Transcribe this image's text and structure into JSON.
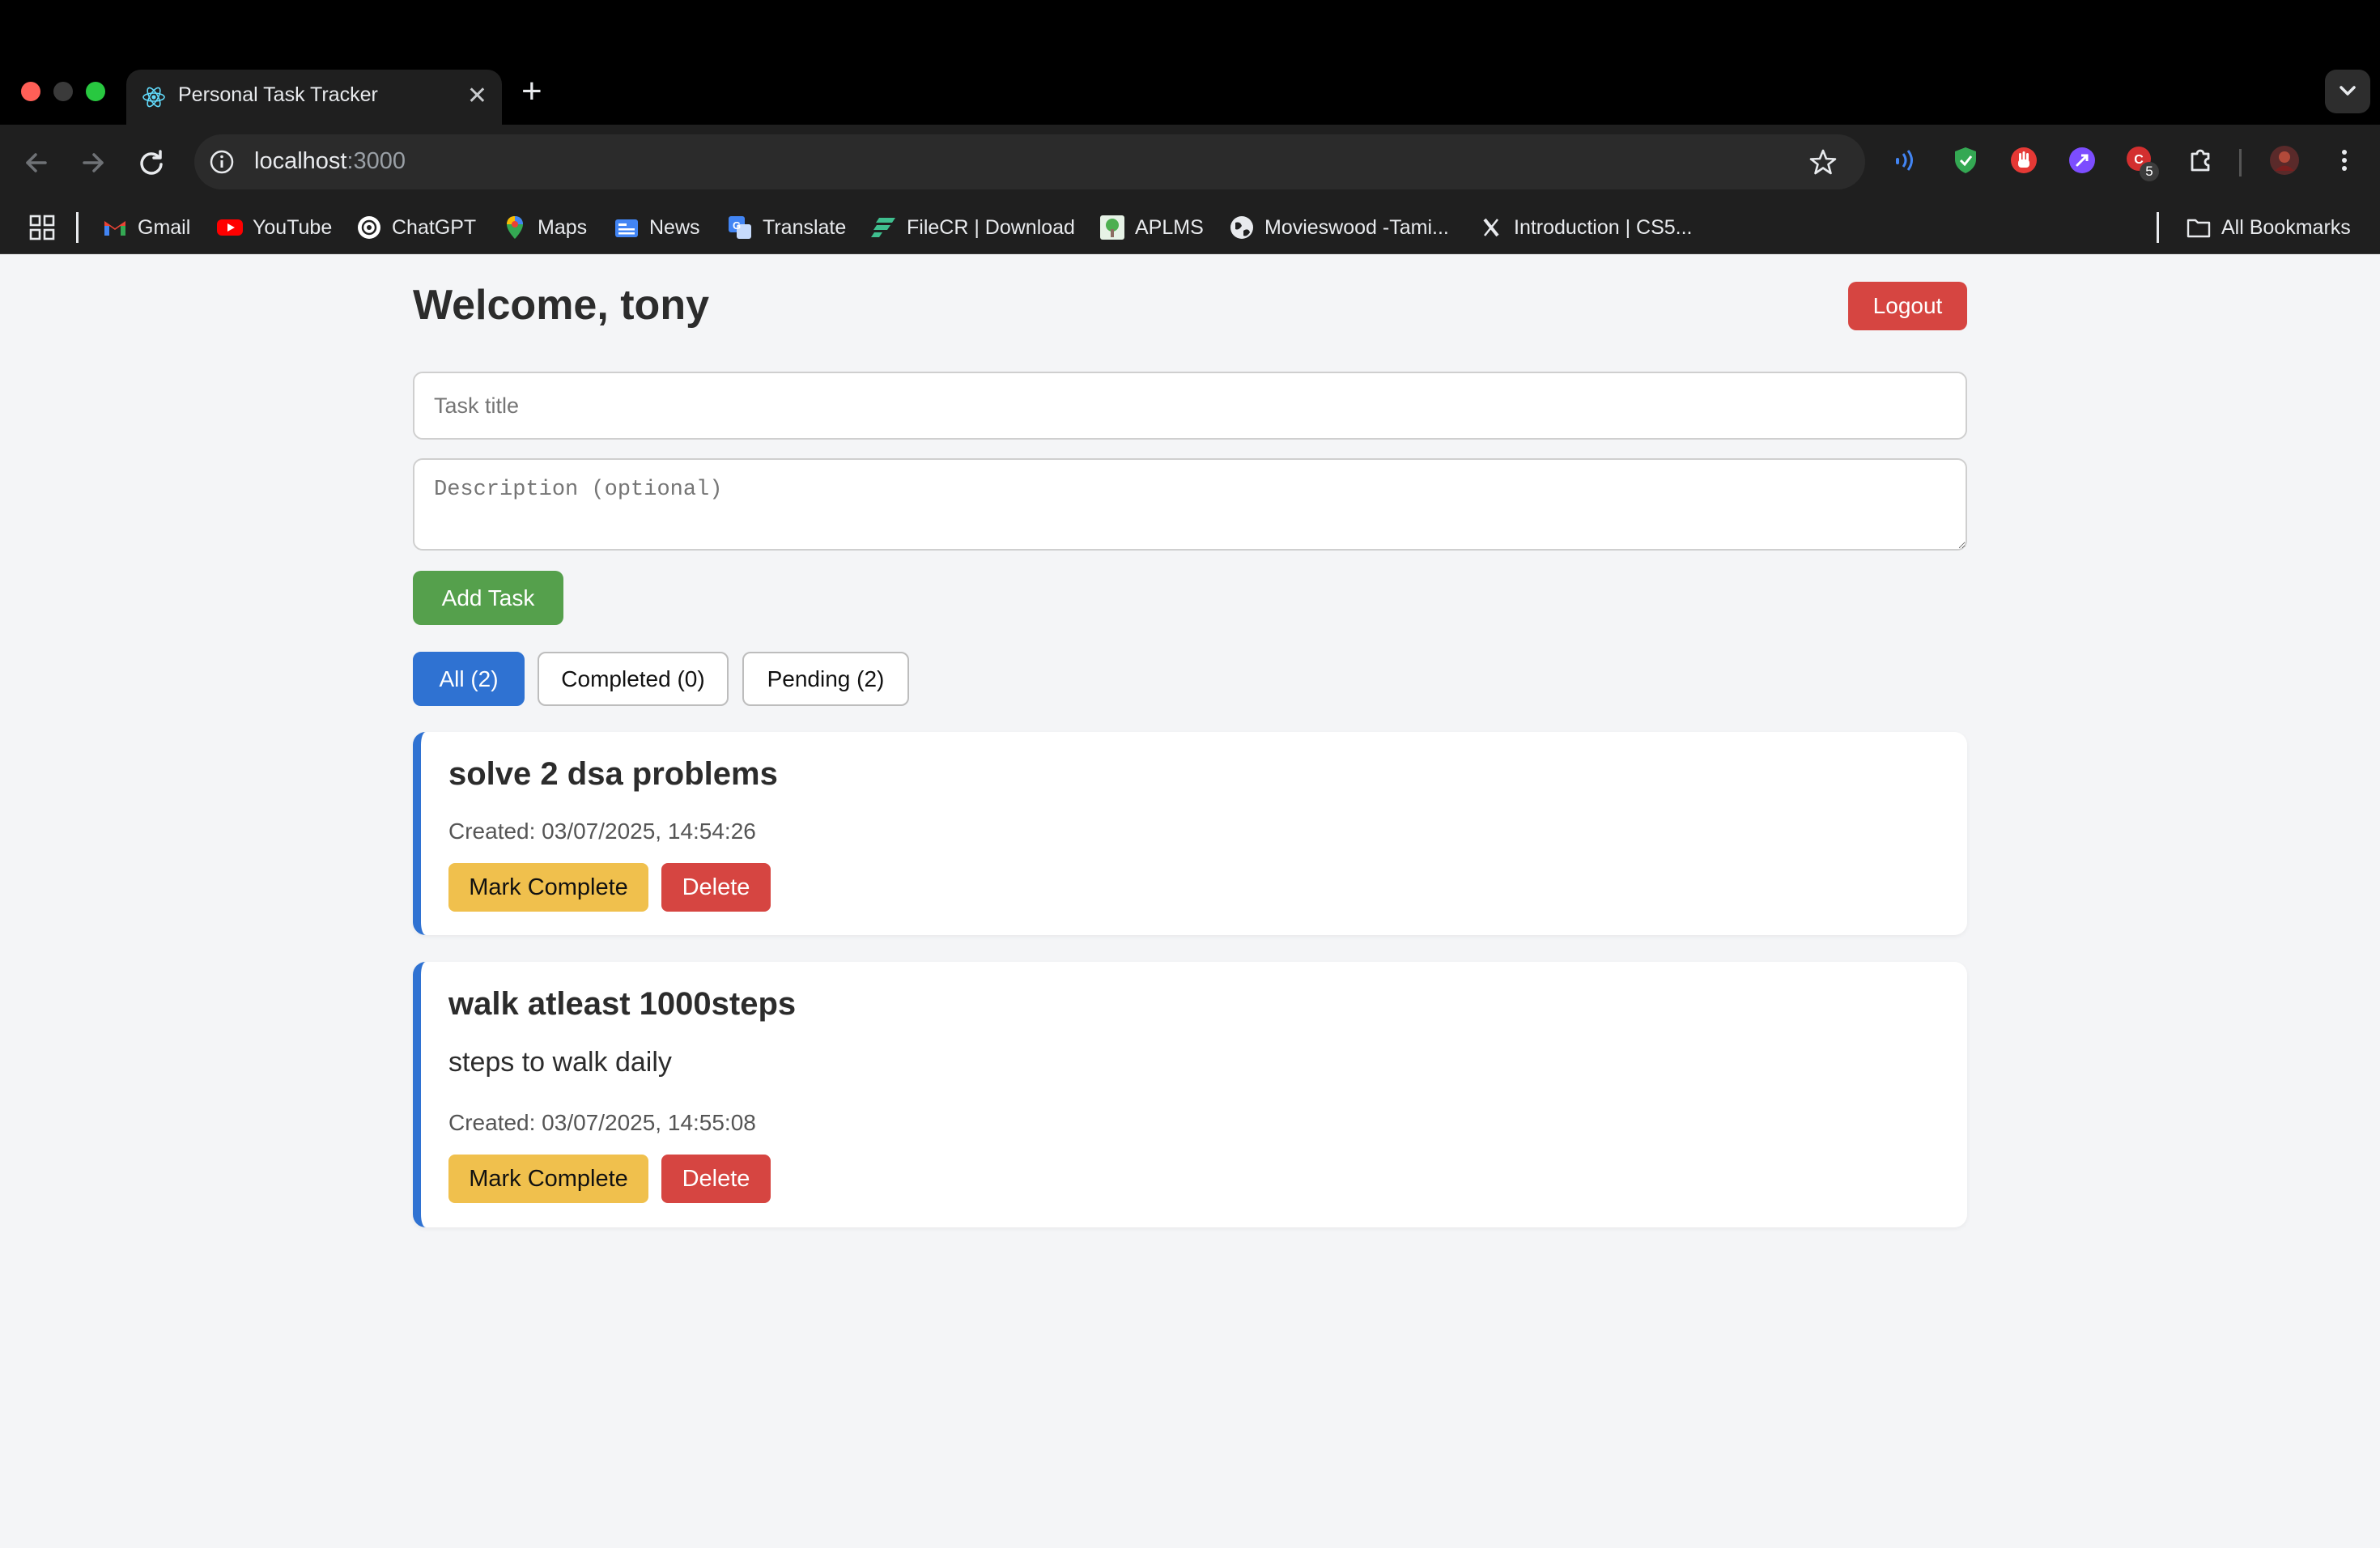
{
  "browser": {
    "tab_title": "Personal Task Tracker",
    "url_host": "localhost",
    "url_port": ":3000",
    "extension_badge": "5",
    "bookmarks": [
      {
        "label": "Gmail",
        "icon": "gmail-icon"
      },
      {
        "label": "YouTube",
        "icon": "youtube-icon"
      },
      {
        "label": "ChatGPT",
        "icon": "chatgpt-icon"
      },
      {
        "label": "Maps",
        "icon": "maps-icon"
      },
      {
        "label": "News",
        "icon": "news-icon"
      },
      {
        "label": "Translate",
        "icon": "translate-icon"
      },
      {
        "label": "FileCR | Download",
        "icon": "filecr-icon"
      },
      {
        "label": "APLMS",
        "icon": "aplms-icon"
      },
      {
        "label": "Movieswood -Tami...",
        "icon": "globe-icon"
      },
      {
        "label": "Introduction | CS5...",
        "icon": "x-logo-icon"
      }
    ],
    "all_bookmarks_label": "All Bookmarks"
  },
  "app": {
    "welcome": "Welcome, tony",
    "logout_label": "Logout",
    "task_title_placeholder": "Task title",
    "description_placeholder": "Description (optional)",
    "add_task_label": "Add Task",
    "filters": [
      {
        "label": "All (2)",
        "active": true
      },
      {
        "label": "Completed (0)",
        "active": false
      },
      {
        "label": "Pending (2)",
        "active": false
      }
    ],
    "tasks": [
      {
        "title": "solve 2 dsa problems",
        "description": "",
        "created": "Created: 03/07/2025, 14:54:26",
        "complete_label": "Mark Complete",
        "delete_label": "Delete"
      },
      {
        "title": "walk atleast 1000steps",
        "description": "steps to walk daily",
        "created": "Created: 03/07/2025, 14:55:08",
        "complete_label": "Mark Complete",
        "delete_label": "Delete"
      }
    ]
  },
  "colors": {
    "primary": "#2f72d2",
    "success": "#55a04c",
    "danger": "#d64541",
    "warning": "#f0c04d",
    "background": "#f4f5f7"
  }
}
